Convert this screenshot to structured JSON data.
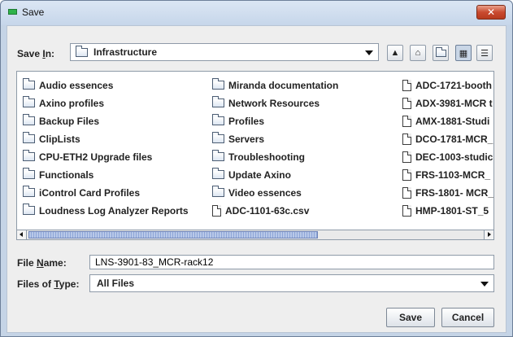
{
  "window": {
    "title": "Save",
    "close_glyph": "✕"
  },
  "save_in": {
    "label_pre": "Save ",
    "label_mnemonic": "I",
    "label_post": "n:",
    "value": "Infrastructure"
  },
  "toolbar": [
    {
      "name": "up-one-level-icon",
      "glyph": "▲"
    },
    {
      "name": "home-icon",
      "glyph": "⌂"
    },
    {
      "name": "new-folder-icon",
      "glyph": ""
    },
    {
      "name": "list-view-icon",
      "glyph": "▦"
    },
    {
      "name": "details-view-icon",
      "glyph": "☰"
    }
  ],
  "files": {
    "col1": [
      "Audio essences",
      "Axino profiles",
      "Backup Files",
      "ClipLists",
      "CPU-ETH2 Upgrade files",
      "Functionals",
      "iControl Card Profiles",
      "Loudness Log Analyzer Reports"
    ],
    "col2": [
      "Miranda documentation",
      "Network Resources",
      "Profiles",
      "Servers",
      "Troubleshooting",
      "Update Axino",
      "Video essences",
      "ADC-1101-63c.csv"
    ],
    "col3": [
      "ADC-1721-booth",
      "ADX-3981-MCR t",
      "AMX-1881-Studi",
      "DCO-1781-MCR_",
      "DEC-1003-studic",
      "FRS-1103-MCR_",
      "FRS-1801- MCR_",
      "HMP-1801-ST_5"
    ]
  },
  "file_name": {
    "label_pre": "File ",
    "label_mnemonic": "N",
    "label_post": "ame:",
    "value": "LNS-3901-83_MCR-rack12"
  },
  "file_type": {
    "label_pre": "Files of ",
    "label_mnemonic": "T",
    "label_post": "ype:",
    "value": "All Files"
  },
  "buttons": {
    "save": "Save",
    "cancel": "Cancel"
  }
}
